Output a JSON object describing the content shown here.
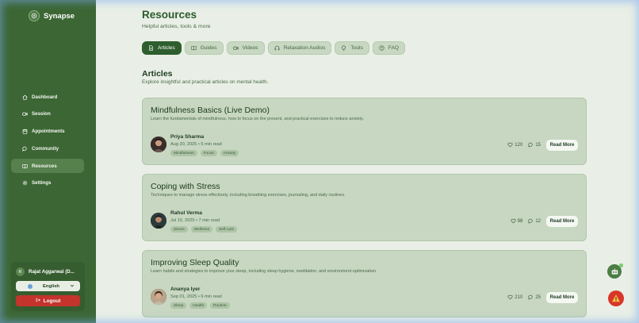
{
  "app": {
    "name": "Synapse"
  },
  "sidebar": {
    "items": [
      {
        "label": "Dashboard",
        "icon": "home-icon"
      },
      {
        "label": "Session",
        "icon": "video-icon"
      },
      {
        "label": "Appointments",
        "icon": "calendar-icon"
      },
      {
        "label": "Community",
        "icon": "chat-icon"
      },
      {
        "label": "Resources",
        "icon": "book-icon",
        "active": true
      },
      {
        "label": "Settings",
        "icon": "gear-icon"
      }
    ],
    "user": {
      "initial": "R",
      "name": "Rajat Aggarwal (D..."
    },
    "language": {
      "selected": "English"
    },
    "logout_label": "Logout"
  },
  "header": {
    "title": "Resources",
    "subtitle": "Helpful articles, tools & more"
  },
  "tabs": [
    {
      "label": "Articles",
      "icon": "document-icon",
      "active": true
    },
    {
      "label": "Guides",
      "icon": "open-book-icon"
    },
    {
      "label": "Videos",
      "icon": "video-icon"
    },
    {
      "label": "Relaxation Audios",
      "icon": "headphones-icon"
    },
    {
      "label": "Tools",
      "icon": "lightbulb-icon"
    },
    {
      "label": "FAQ",
      "icon": "help-icon"
    }
  ],
  "section": {
    "title": "Articles",
    "subtitle": "Explore insightful and practical articles on mental health."
  },
  "articles": [
    {
      "title": "Mindfulness Basics (Live Demo)",
      "description": "Learn the fundamentals of mindfulness, how to focus on the present, and practical exercises to reduce anxiety.",
      "author": "Priya Sharma",
      "meta": "Aug 20, 2025 • 5 min read",
      "tags": [
        "Mindfulness",
        "Focus",
        "Anxiety"
      ],
      "likes": "120",
      "comments": "15",
      "button": "Read More"
    },
    {
      "title": "Coping with Stress",
      "description": "Techniques to manage stress effectively, including breathing exercises, journaling, and daily routines.",
      "author": "Rahul Verma",
      "meta": "Jul 15, 2025 • 7 min read",
      "tags": [
        "Stress",
        "Wellness",
        "Self-care"
      ],
      "likes": "98",
      "comments": "12",
      "button": "Read More"
    },
    {
      "title": "Improving Sleep Quality",
      "description": "Learn habits and strategies to improve your sleep, including sleep hygiene, meditation, and environment optimization.",
      "author": "Ananya Iyer",
      "meta": "Sep 01, 2025 • 6 min read",
      "tags": [
        "Sleep",
        "Health",
        "Routine"
      ],
      "likes": "210",
      "comments": "25",
      "button": "Read More"
    }
  ],
  "colors": {
    "sidebar_bg": "#3c6634",
    "page_bg": "#e9efe6",
    "card_bg": "#c7d7c1",
    "active_tab": "#2e5e2e",
    "logout": "#c4332c"
  }
}
